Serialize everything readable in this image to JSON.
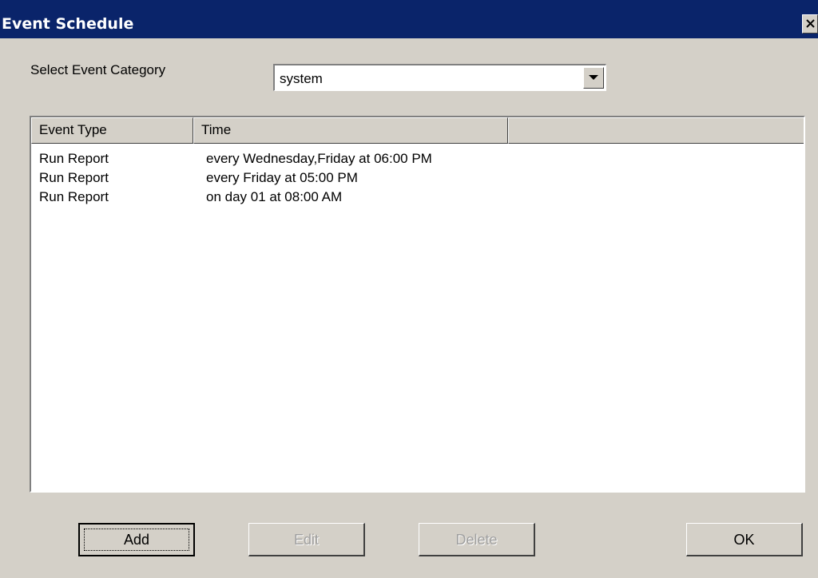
{
  "window": {
    "title": "Event Schedule",
    "close_label": "×"
  },
  "category": {
    "label": "Select Event Category",
    "selected": "system"
  },
  "table": {
    "columns": [
      "Event Type",
      "Time",
      ""
    ],
    "rows": [
      {
        "type": "Run Report",
        "time": "every Wednesday,Friday at 06:00 PM"
      },
      {
        "type": "Run Report",
        "time": "every Friday at 05:00 PM"
      },
      {
        "type": "Run Report",
        "time": "on day 01 at 08:00 AM"
      }
    ]
  },
  "buttons": {
    "add": "Add",
    "edit": "Edit",
    "delete": "Delete",
    "ok": "OK"
  },
  "colors": {
    "titlebar": "#0a246a",
    "face": "#d4d0c8",
    "disabled_text": "#a0a0a0"
  },
  "icons": {
    "close": "close-icon",
    "dropdown": "chevron-down-icon"
  }
}
